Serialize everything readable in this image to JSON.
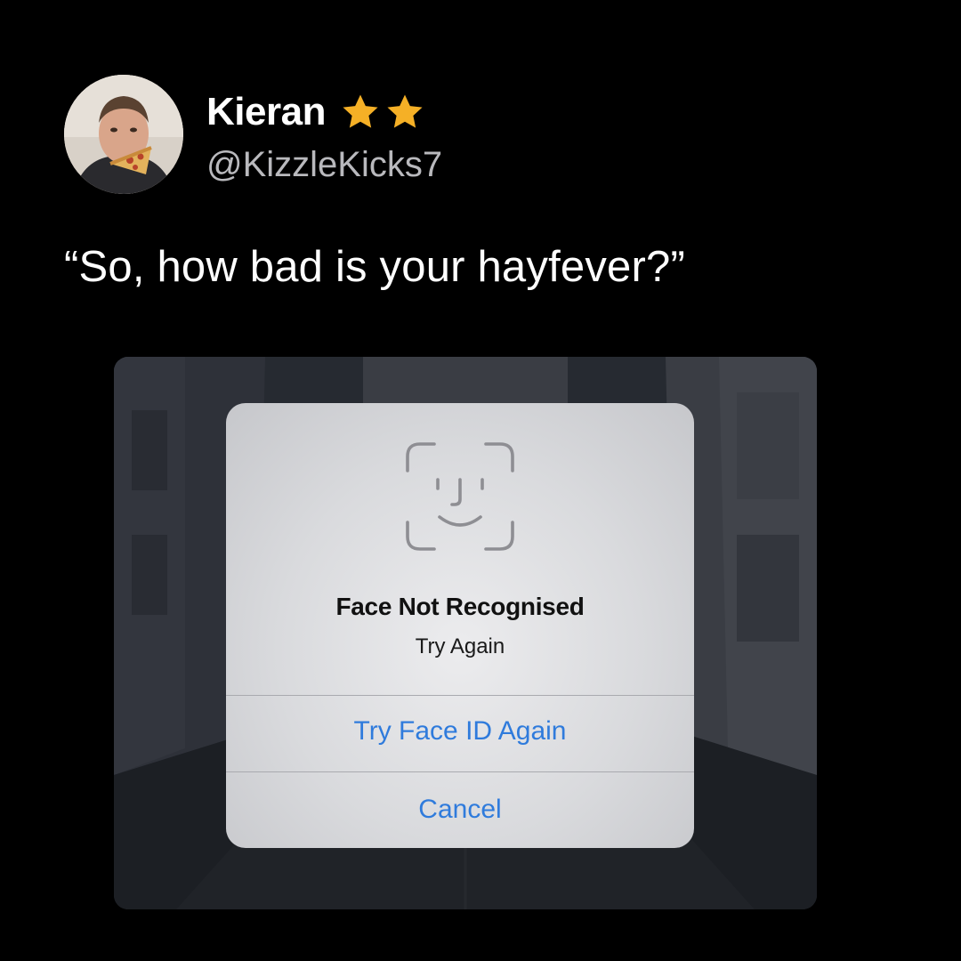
{
  "post": {
    "display_name": "Kieran",
    "handle": "@KizzleKicks7",
    "verified_icons": [
      "star-icon",
      "star-icon"
    ],
    "star_color": "#f5b026",
    "quote": "“So, how bad is your hayfever?”"
  },
  "dialog": {
    "icon": "face-id-icon",
    "title": "Face Not Recognised",
    "subtitle": "Try Again",
    "primary_button": "Try Face ID Again",
    "cancel_button": "Cancel",
    "button_color": "#2f7bdc"
  }
}
